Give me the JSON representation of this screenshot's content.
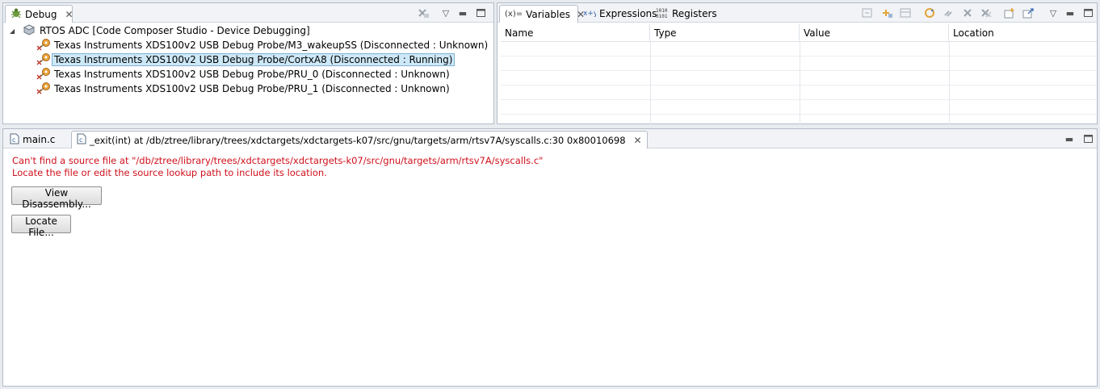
{
  "debug_view": {
    "tab_label": "Debug",
    "session": "RTOS ADC [Code Composer Studio - Device Debugging]",
    "targets": [
      {
        "label": "Texas Instruments XDS100v2 USB Debug Probe/M3_wakeupSS (Disconnected : Unknown)",
        "selected": false
      },
      {
        "label": "Texas Instruments XDS100v2 USB Debug Probe/CortxA8 (Disconnected : Running)",
        "selected": true
      },
      {
        "label": "Texas Instruments XDS100v2 USB Debug Probe/PRU_0 (Disconnected : Unknown)",
        "selected": false
      },
      {
        "label": "Texas Instruments XDS100v2 USB Debug Probe/PRU_1 (Disconnected : Unknown)",
        "selected": false
      }
    ]
  },
  "variables_view": {
    "tabs": [
      {
        "label": "Variables",
        "prefix": "(x)=",
        "active": true
      },
      {
        "label": "Expressions",
        "active": false
      },
      {
        "label": "Registers",
        "active": false
      }
    ],
    "columns": [
      "Name",
      "Type",
      "Value",
      "Location"
    ]
  },
  "editor": {
    "tabs": [
      {
        "label": "main.c",
        "active": false
      },
      {
        "label": "_exit(int) at /db/ztree/library/trees/xdctargets/xdctargets-k07/src/gnu/targets/arm/rtsv7A/syscalls.c:30 0x80010698",
        "active": true
      }
    ],
    "error_line1": "Can't find a source file at \"/db/ztree/library/trees/xdctargets/xdctargets-k07/src/gnu/targets/arm/rtsv7A/syscalls.c\"",
    "error_line2": "Locate the file or edit the source lookup path to include its location.",
    "view_disassembly_label": "View Disassembly...",
    "locate_file_label": "Locate File..."
  },
  "colors": {
    "error_text": "#d0101c",
    "selection_bg": "#cde8f7",
    "panel_border": "#b4bcc8"
  }
}
